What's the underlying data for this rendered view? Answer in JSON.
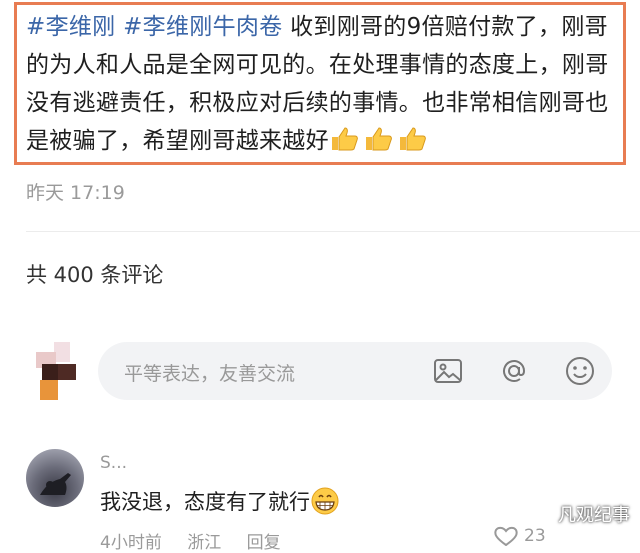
{
  "post": {
    "hashtag1": "#李维刚",
    "hashtag2": "#李维刚牛肉卷",
    "text": " 收到刚哥的9倍赔付款了，刚哥的为人和人品是全网可见的。在处理事情的态度上，刚哥没有逃避责任，积极应对后续的事情。也非常相信刚哥也是被骗了，希望刚哥越来越好",
    "emoji_icons": [
      "thumbs-up-icon",
      "thumbs-up-icon",
      "thumbs-up-icon"
    ],
    "time": "昨天 17:19",
    "border_color": "#e87c52",
    "hashtag_color": "#3b66a8"
  },
  "comments": {
    "count_label": "共 400 条评论",
    "input_placeholder": "平等表达，友善交流",
    "input_icons": [
      "image-icon",
      "at-icon",
      "emoji-icon"
    ]
  },
  "comment_item": {
    "username": "S...",
    "text": "我没退，态度有了就行",
    "emoji_icon": "grinning-face-icon",
    "meta_time": "4小时前",
    "meta_location": "浙江",
    "meta_reply": "回复",
    "like_count": "23"
  },
  "watermark": "凡观纪事"
}
